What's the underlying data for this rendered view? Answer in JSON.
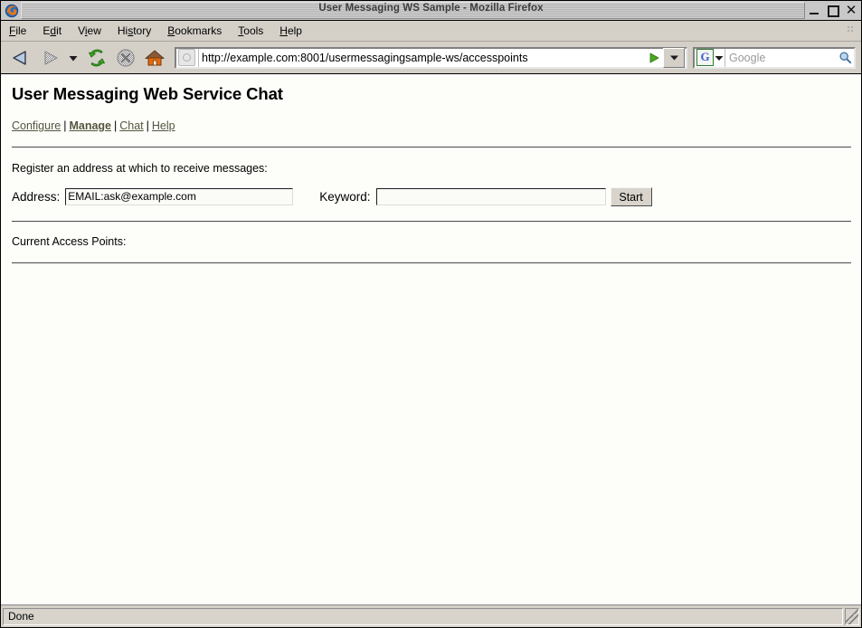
{
  "window": {
    "title": "User Messaging WS Sample - Mozilla Firefox",
    "app_icon": "firefox-logo-icon",
    "controls": {
      "minimize": "minimize-icon",
      "maximize": "maximize-icon",
      "close": "close-icon"
    }
  },
  "menubar": {
    "items": [
      {
        "label": "File",
        "pre": "F",
        "accel": "i",
        "post": "le"
      },
      {
        "label": "Edit",
        "pre": "E",
        "accel": "d",
        "post": "it"
      },
      {
        "label": "View",
        "pre": "V",
        "accel": "i",
        "post": "ew"
      },
      {
        "label": "History",
        "pre": "Hi",
        "accel": "s",
        "post": "tory"
      },
      {
        "label": "Bookmarks",
        "pre": "B",
        "accel": "o",
        "post": "okmarks"
      },
      {
        "label": "Tools",
        "pre": "T",
        "accel": "o",
        "post": "ols"
      },
      {
        "label": "Help",
        "pre": "H",
        "accel": "e",
        "post": "lp"
      }
    ]
  },
  "toolbar": {
    "back": "back-arrow-icon",
    "forward": "forward-arrow-icon",
    "history_dropdown": "chevron-down-icon",
    "reload": "reload-icon",
    "stop": "stop-icon",
    "home": "home-icon",
    "url": "http://example.com:8001/usermessagingsample-ws/accesspoints",
    "go_icon": "go-arrow-icon",
    "url_dropdown_icon": "chevron-down-icon",
    "favicon": "page-favicon-icon"
  },
  "search": {
    "engine_glyph": "G",
    "engine_dropdown_icon": "chevron-down-icon",
    "placeholder": "Google",
    "value": "",
    "magnifier_icon": "magnifier-icon"
  },
  "page": {
    "heading": "User Messaging Web Service Chat",
    "nav": [
      {
        "label": "Configure",
        "current": false
      },
      {
        "label": "Manage",
        "current": true
      },
      {
        "label": "Chat",
        "current": false
      },
      {
        "label": "Help",
        "current": false
      }
    ],
    "nav_separator": "|",
    "register_instruction": "Register an address at which to receive messages:",
    "form": {
      "address_label": "Address:",
      "address_value": "EMAIL:ask@example.com",
      "address_placeholder": "",
      "keyword_label": "Keyword:",
      "keyword_value": "",
      "keyword_placeholder": "",
      "start_button": "Start"
    },
    "access_points_label": "Current Access Points:",
    "access_points": []
  },
  "statusbar": {
    "text": "Done",
    "resize_grip": "resize-grip-icon"
  },
  "colors": {
    "chrome": "#d4d0c8",
    "page_bg": "#fdfdfa",
    "link": "#55553f",
    "title_text": "#3c3c3c"
  }
}
